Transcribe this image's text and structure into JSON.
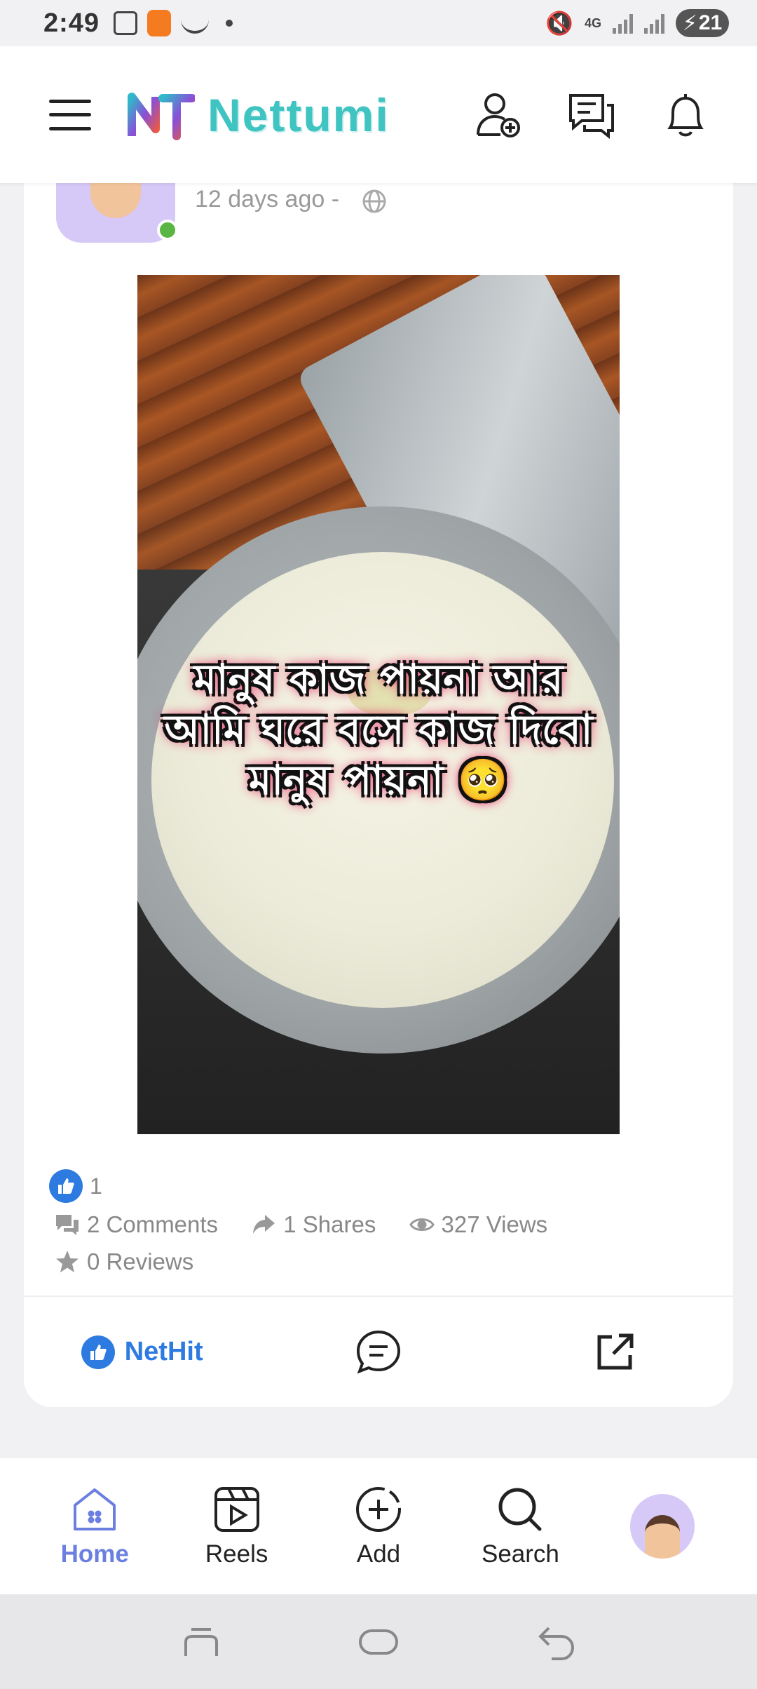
{
  "status_bar": {
    "time": "2:49",
    "network": "4G",
    "battery": "21"
  },
  "header": {
    "app_name": "Nettumi",
    "brand_color": "#3fc4c2"
  },
  "post": {
    "time_ago": "12 days ago -",
    "media_caption": [
      "মানুষ কাজ পায়না আর",
      "আমি ঘরে বসে কাজ দিবো",
      "মানুষ পায়না 🥺"
    ],
    "reaction_count": "1",
    "stats": {
      "comments": "2 Comments",
      "shares": "1 Shares",
      "views": "327 Views",
      "reviews": "0 Reviews"
    },
    "actions": {
      "nethit_label": "NetHit"
    }
  },
  "bottom_nav": {
    "items": [
      {
        "label": "Home",
        "icon": "home-icon",
        "active": true
      },
      {
        "label": "Reels",
        "icon": "reels-icon"
      },
      {
        "label": "Add",
        "icon": "add-icon"
      },
      {
        "label": "Search",
        "icon": "search-icon"
      }
    ],
    "accent_color": "#6b7fe0"
  }
}
